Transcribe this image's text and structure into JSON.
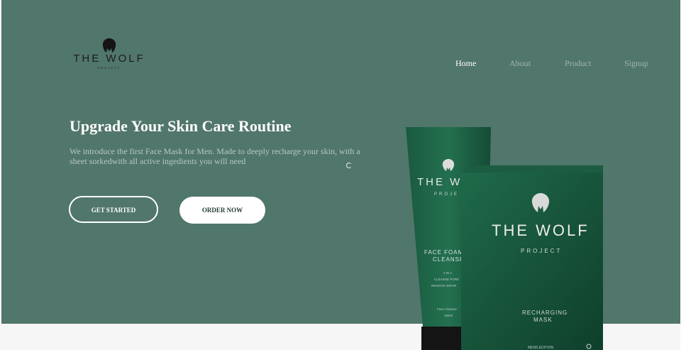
{
  "brand": {
    "name": "THE WOLF",
    "sub": "PROJECT"
  },
  "nav": {
    "items": [
      "Home",
      "About",
      "Product",
      "Signup"
    ],
    "active": "Home"
  },
  "hero": {
    "headline": "Upgrade Your Skin Care Routine",
    "intro": "We introduce the first Face Mask for Men. Made to deeply recharge your skin, with a sheet sorkedwith all active ingedients you will need",
    "get_started": "GET STARTED",
    "order_now": "ORDER NOW"
  },
  "product": {
    "tube": {
      "brand": "THE WOL",
      "sub": "PROJE",
      "line1": "FACE FOAM",
      "line2": "CLEANSE",
      "detail1": "2 IN 1",
      "detail2": "CLEANSE PORE",
      "detail3": "REMOVE IMPUR",
      "volume1": "Face Cleanse",
      "volume2": "100ml"
    },
    "box": {
      "brand": "THE WOLF",
      "sub": "PROJECT",
      "line1": "RECHARGING",
      "line2": "MASK",
      "edition": "MENS EDITION"
    }
  },
  "colors": {
    "hero_bg": "#51766b",
    "product_green": "#1b5e43",
    "page_bg": "#f6f6f6"
  }
}
